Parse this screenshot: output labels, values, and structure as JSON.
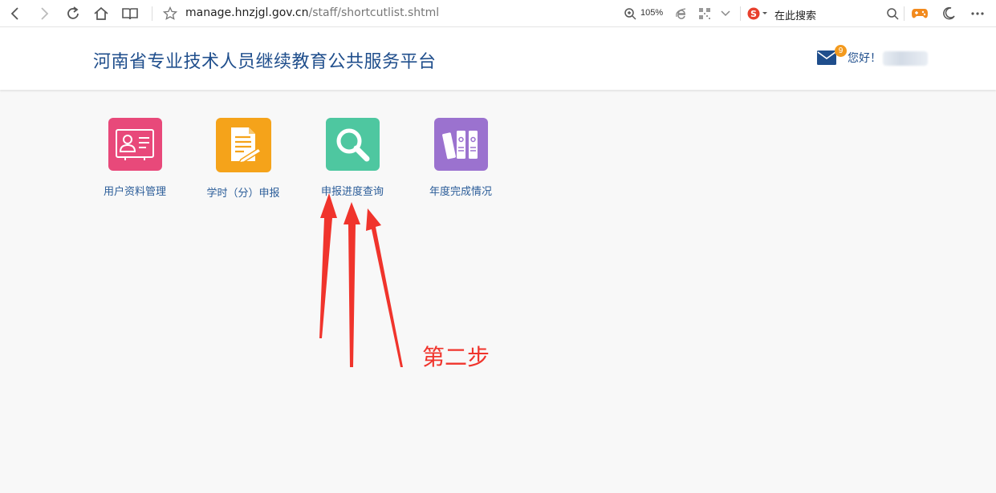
{
  "browser": {
    "url_host": "manage.hnzjgl.gov.cn",
    "url_path": "/staff/shortcutlist.shtml",
    "zoom": "105%",
    "search_placeholder": "在此搜索",
    "icons": [
      "back-icon",
      "forward-icon",
      "reload-icon",
      "home-icon",
      "reading-mode-icon",
      "bookmark-star-icon",
      "zoom-icon",
      "ie-compat-icon",
      "qr-code-icon",
      "chevron-down-icon",
      "sogou-search-icon",
      "search-icon",
      "game-icon",
      "night-mode-icon",
      "more-icon"
    ]
  },
  "header": {
    "title": "河南省专业技术人员继续教育公共服务平台",
    "mail_badge": "9",
    "greeting": "您好！"
  },
  "shortcuts": [
    {
      "label": "用户资料管理",
      "color": "#e8497a",
      "icon": "user-card-icon"
    },
    {
      "label": "学时（分）申报",
      "color": "#f5a31a",
      "icon": "document-pen-icon"
    },
    {
      "label": "申报进度查询",
      "color": "#4ec7a0",
      "icon": "magnifier-icon"
    },
    {
      "label": "年度完成情况",
      "color": "#9b72cf",
      "icon": "binders-icon"
    }
  ],
  "annotation": {
    "text": "第二步",
    "color": "#f0342c"
  }
}
